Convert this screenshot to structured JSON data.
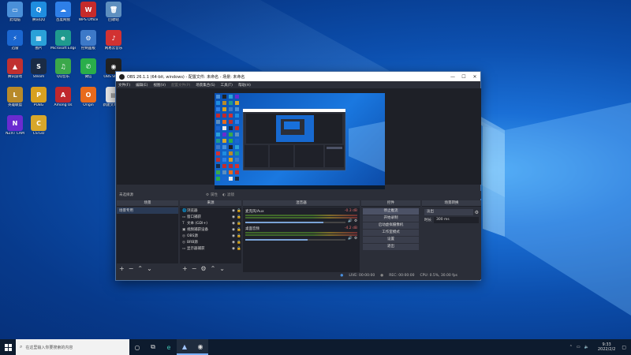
{
  "desktop": {
    "icons": [
      {
        "label": "此电脑",
        "color": "#4a90d9",
        "glyph": "▭"
      },
      {
        "label": "腾讯QQ",
        "color": "#1f8de0",
        "glyph": "Q"
      },
      {
        "label": "百度网盘",
        "color": "#2e7fe8",
        "glyph": "☁"
      },
      {
        "label": "WPS Office",
        "color": "#c62b2b",
        "glyph": "W"
      },
      {
        "label": "回收站",
        "color": "#5e8fbf",
        "glyph": "🗑"
      },
      {
        "label": "迅雷",
        "color": "#1b67d1",
        "glyph": "⚡"
      },
      {
        "label": "图片",
        "color": "#2aa1d8",
        "glyph": "▦"
      },
      {
        "label": "Microsoft Edge",
        "color": "#1f9a8e",
        "glyph": "e"
      },
      {
        "label": "控制面板",
        "color": "#3d79c8",
        "glyph": "⚙"
      },
      {
        "label": "网易云音乐",
        "color": "#d23232",
        "glyph": "♪"
      },
      {
        "label": "腾讯游戏",
        "color": "#c03030",
        "glyph": "▲"
      },
      {
        "label": "Steam",
        "color": "#1a2b45",
        "glyph": "S"
      },
      {
        "label": "QQ音乐",
        "color": "#3ba84a",
        "glyph": "♫"
      },
      {
        "label": "微信",
        "color": "#2aae4a",
        "glyph": "✆"
      },
      {
        "label": "OBS Studio",
        "color": "#222",
        "glyph": "◉"
      },
      {
        "label": "英雄联盟",
        "color": "#b88a2a",
        "glyph": "L"
      },
      {
        "label": "PUBG",
        "color": "#d8a020",
        "glyph": "P"
      },
      {
        "label": "Among Us",
        "color": "#c0282d",
        "glyph": "A"
      },
      {
        "label": "Origin",
        "color": "#e86a1c",
        "glyph": "O"
      },
      {
        "label": "新建文本文档",
        "color": "#e8e8e8",
        "glyph": "▤"
      },
      {
        "label": "NZXT CAM",
        "color": "#6a2bd0",
        "glyph": "N"
      },
      {
        "label": "CS:GO",
        "color": "#d8a72b",
        "glyph": "C"
      }
    ]
  },
  "obs": {
    "title": "OBS 26.1.1 (64-bit, windows) - 配置文件: 未命名 - 场景: 未命名",
    "menu": [
      "文件(F)",
      "编辑(E)",
      "视图(V)",
      "配置文件(P)",
      "场景集合(S)",
      "工具(T)",
      "帮助(H)"
    ],
    "bottom_source": "未选择源",
    "props_label": "属性",
    "filters_label": "滤镜",
    "docks": {
      "scenes": {
        "title": "场景",
        "items": [
          "场景专用"
        ]
      },
      "sources": {
        "title": "来源",
        "items": [
          {
            "icon": "🌐",
            "label": "浏览器"
          },
          {
            "icon": "▭",
            "label": "窗口捕获"
          },
          {
            "icon": "T",
            "label": "文本 (GDI+)"
          },
          {
            "icon": "▣",
            "label": "视频捕获设备"
          },
          {
            "icon": "◎",
            "label": "OBS源"
          },
          {
            "icon": "◎",
            "label": "BRB源"
          },
          {
            "icon": "▭",
            "label": "显示器捕获"
          }
        ]
      },
      "mixer": {
        "title": "混音器",
        "tracks": [
          {
            "name": "麦克风/Aux",
            "db": "-0.3 dB",
            "level": 0.78
          },
          {
            "name": "桌面音频",
            "db": "-4.2 dB",
            "level": 0.62
          }
        ]
      },
      "controls": {
        "title": "控件",
        "buttons": [
          "停止推流",
          "开始录制",
          "启动虚拟摄像机",
          "工作室模式",
          "设置",
          "退出"
        ]
      },
      "transitions": {
        "title": "场景转换",
        "type": "淡出",
        "duration_label": "时长",
        "duration": "300 ms"
      }
    },
    "status": {
      "live": "LIVE: 00:00:00",
      "rec": "REC: 00:00:00",
      "cpu": "CPU: 0.5%, 30.00 fps"
    }
  },
  "taskbar": {
    "search_placeholder": "在这里输入你要搜索的内容",
    "time": "9:33",
    "date": "2022/2/2"
  }
}
